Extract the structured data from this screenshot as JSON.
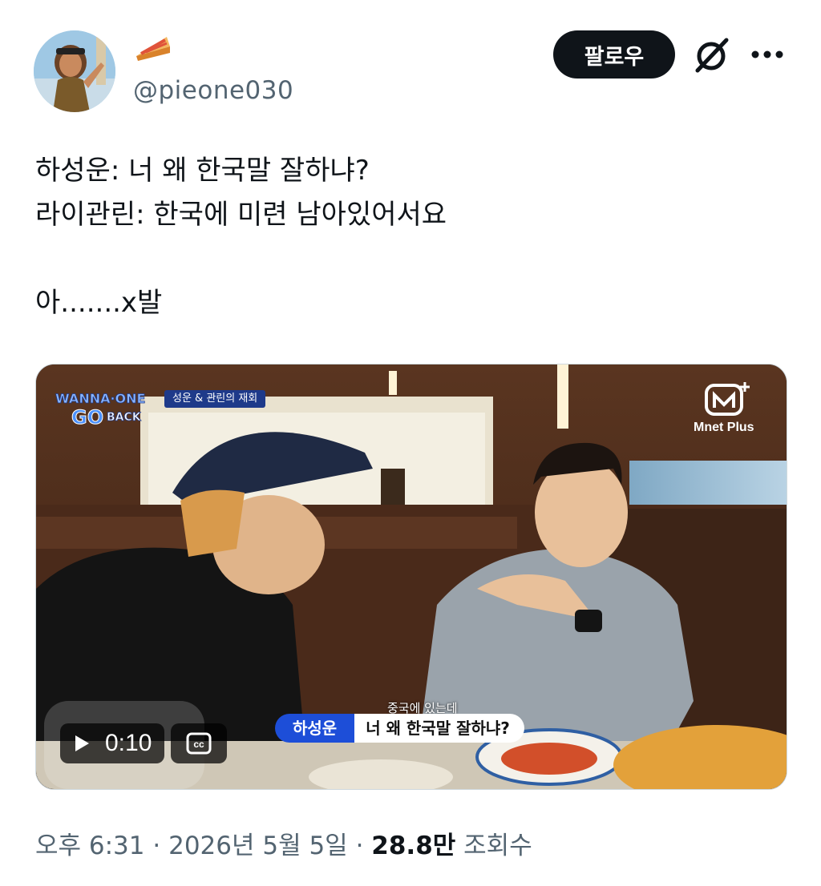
{
  "author": {
    "handle": "@pieone030",
    "display_name_icon": "pie-emoji",
    "avatar_icon": "avatar-image"
  },
  "actions": {
    "follow_label": "팔로우",
    "grok_icon": "grok-icon",
    "more_icon": "more-icon"
  },
  "tweet": {
    "lines": [
      "하성운: 너 왜 한국말 잘하냐?",
      "라이관린: 한국에 미련 남아있어서요",
      "",
      "아.......x발"
    ]
  },
  "media": {
    "show_logo_lines": [
      "WANNA·ONE",
      "GO",
      "BACK"
    ],
    "episode_tag": "성운 & 관린의 재회",
    "broadcaster": "Mnet Plus",
    "subtitle_caption": "중국에 있는데",
    "subtitle_speaker": "하성운",
    "subtitle_text": "너 왜 한국말 잘하냐?",
    "duration": "0:10",
    "play_icon": "play-icon",
    "cc_label": "cc"
  },
  "meta": {
    "time": "오후 6:31",
    "separator": "·",
    "date": "2026년 5월 5일",
    "views_count": "28.8만",
    "views_label": "조회수"
  }
}
